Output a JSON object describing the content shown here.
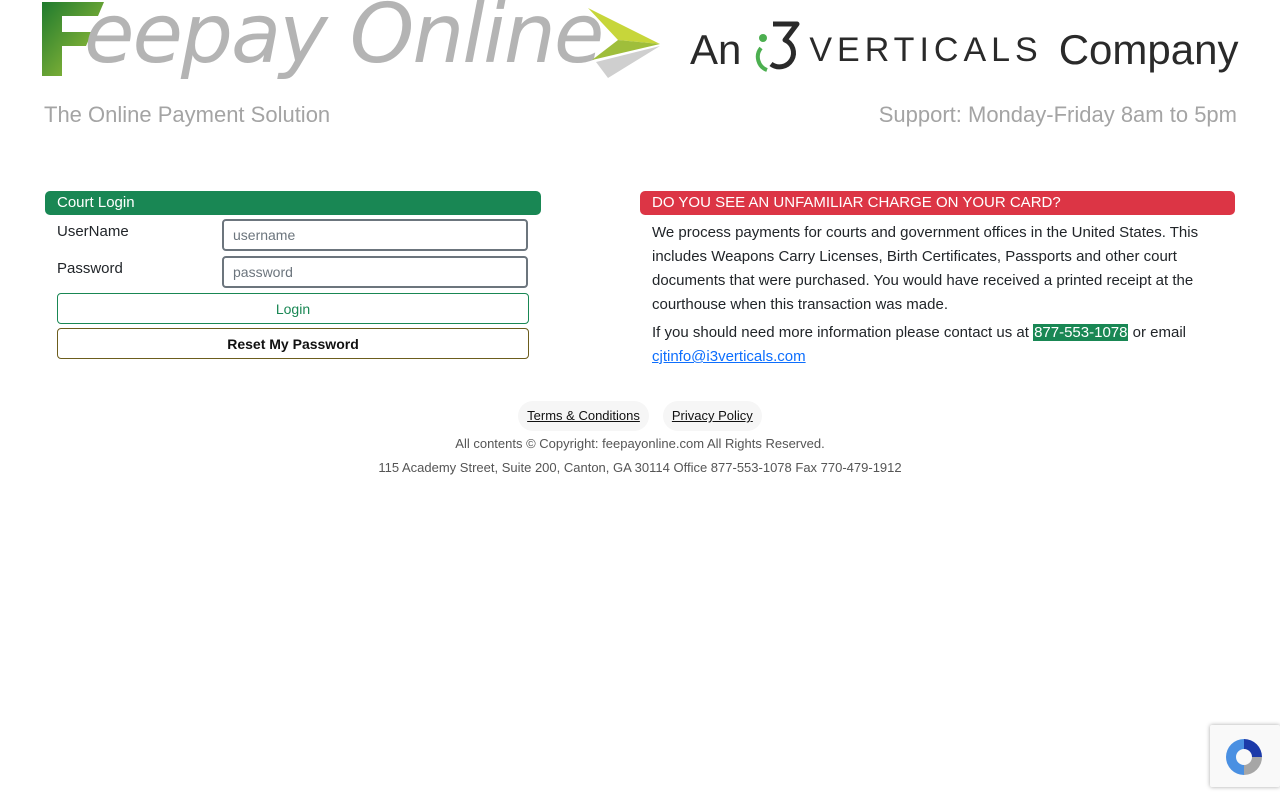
{
  "header": {
    "logo_text": "eepay Online",
    "tagline": "The Online Payment Solution",
    "company_prefix": "An",
    "company_name": "VERTICALS",
    "company_suffix": "Company",
    "support": "Support: Monday-Friday 8am to 5pm"
  },
  "login": {
    "title": "Court Login",
    "username_label": "UserName",
    "username_placeholder": "username",
    "username_value": "",
    "password_label": "Password",
    "password_placeholder": "password",
    "password_value": "",
    "login_button": "Login",
    "reset_button": "Reset My Password"
  },
  "alert": {
    "title": "DO YOU SEE AN UNFAMILIAR CHARGE ON YOUR CARD?",
    "paragraph1": "We process payments for courts and government offices in the United States. This includes Weapons Carry Licenses, Birth Certificates, Passports and other court documents that were purchased. You would have received a printed receipt at the courthouse when this transaction was made.",
    "contact_prefix": "If you should need more information please contact us at",
    "phone": "877-553-1078",
    "contact_mid": "or email",
    "email": "cjtinfo@i3verticals.com"
  },
  "footer": {
    "terms_link": "Terms & Conditions",
    "privacy_link": "Privacy Policy",
    "copyright": "All contents © Copyright: feepayonline.com All Rights Reserved.",
    "address": "115 Academy Street, Suite 200, Canton, GA 30114 Office 877-553-1078 Fax 770-479-1912"
  },
  "colors": {
    "green": "#198754",
    "red": "#dc3545",
    "link": "#0d6efd",
    "muted": "#a4a4a4"
  },
  "icons": {
    "logo_f": "feepay-f-logo-icon",
    "logo_arrow": "feepay-arrow-logo-icon",
    "i3_mark": "i3-logo-icon",
    "recaptcha": "recaptcha-icon"
  }
}
